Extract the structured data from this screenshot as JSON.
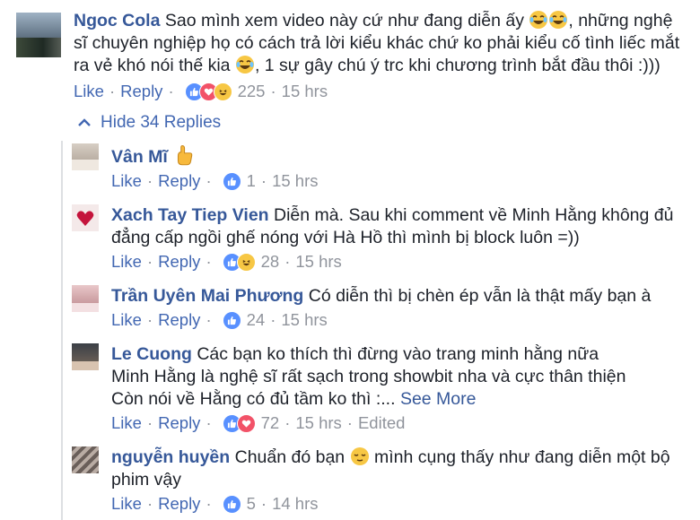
{
  "main_comment": {
    "name": "Ngoc Cola",
    "text_1": "Sao mình xem video này cứ như đang diễn ấy ",
    "text_2": ", những nghệ sĩ chuyên nghiệp họ có cách trả lời kiểu khác chứ ko phải kiểu cố tình liếc mắt ra vẻ khó nói thế kia ",
    "text_3": ", 1 sự gây chú ý trc khi chương trình bắt đầu thôi :)))",
    "like": "Like",
    "reply": "Reply",
    "reaction_count": "225",
    "time": "15 hrs"
  },
  "hide_replies": {
    "label": "Hide 34 Replies"
  },
  "replies": [
    {
      "name": "Vân Mĩ",
      "text": "",
      "like": "Like",
      "reply": "Reply",
      "reaction_count": "1",
      "time": "15 hrs"
    },
    {
      "name": "Xach Tay Tiep Vien",
      "text": " Diễn mà. Sau khi comment về Minh Hằng không đủ đẳng cấp ngồi ghế nóng với Hà Hồ thì mình bị block luôn =))",
      "like": "Like",
      "reply": "Reply",
      "reaction_count": "28",
      "time": "15 hrs"
    },
    {
      "name": "Trần Uyên Mai Phương",
      "text": " Có diễn thì bị chèn ép vẫn là thật mấy bạn à",
      "like": "Like",
      "reply": "Reply",
      "reaction_count": "24",
      "time": "15 hrs"
    },
    {
      "name": "Le Cuong",
      "line_1": " Các bạn ko thích thì đừng vào trang minh hằng nữa",
      "line_2": "Minh Hằng là nghệ sĩ rất sạch trong showbit nha và cực thân thiện",
      "line_3": "Còn nói về Hằng có đủ tầm ko thì :...",
      "see_more": "See More",
      "like": "Like",
      "reply": "Reply",
      "reaction_count": "72",
      "time": "15 hrs",
      "edited": "Edited"
    },
    {
      "name": "nguyễn huyền",
      "text_1": " Chuẩn đó bạn ",
      "text_2": " mình cụng thấy như đang diễn một bộ phim vậy",
      "like": "Like",
      "reply": "Reply",
      "reaction_count": "5",
      "time": "14 hrs"
    }
  ],
  "separator": "·",
  "colors": {
    "link": "#4267b2",
    "name": "#365899",
    "meta": "#90949c",
    "like_blue": "#5890ff",
    "love_red": "#f25268",
    "haha_yellow": "#f7c744"
  }
}
